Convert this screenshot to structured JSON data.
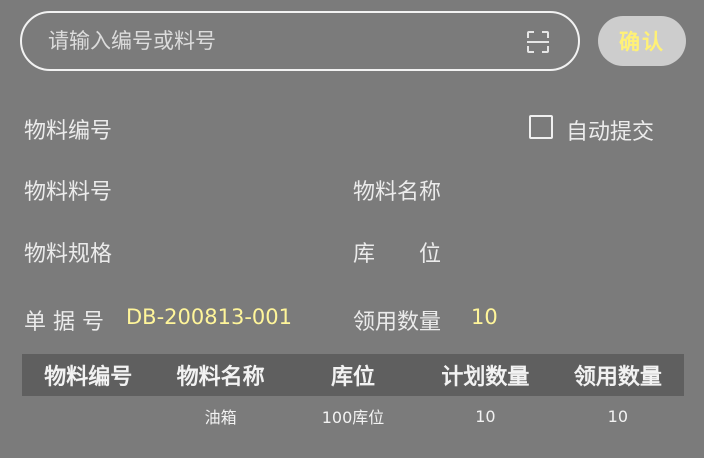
{
  "search": {
    "placeholder": "请输入编号或料号",
    "value": ""
  },
  "confirm_label": "确认",
  "scan_icon": "scan-icon",
  "fields": {
    "material_code_label": "物料编号",
    "auto_submit_label": "自动提交",
    "auto_submit_checked": false,
    "material_number_label": "物料料号",
    "material_name_label": "物料名称",
    "material_spec_label": "物料规格",
    "location_label": "库　　位",
    "document_no_label": "单 据 号",
    "document_no_value": "DB-200813-001",
    "issue_qty_label": "领用数量",
    "issue_qty_value": "10"
  },
  "table": {
    "headers": [
      "物料编号",
      "物料名称",
      "库位",
      "计划数量",
      "领用数量"
    ],
    "rows": [
      [
        "",
        "油箱",
        "100库位",
        "10",
        "10"
      ]
    ]
  },
  "colors": {
    "background": "#7b7b7b",
    "accent_value": "#fff59a",
    "button_bg": "#cdcdcd",
    "button_text": "#fff176",
    "table_header_bg": "#5f5f5f"
  }
}
